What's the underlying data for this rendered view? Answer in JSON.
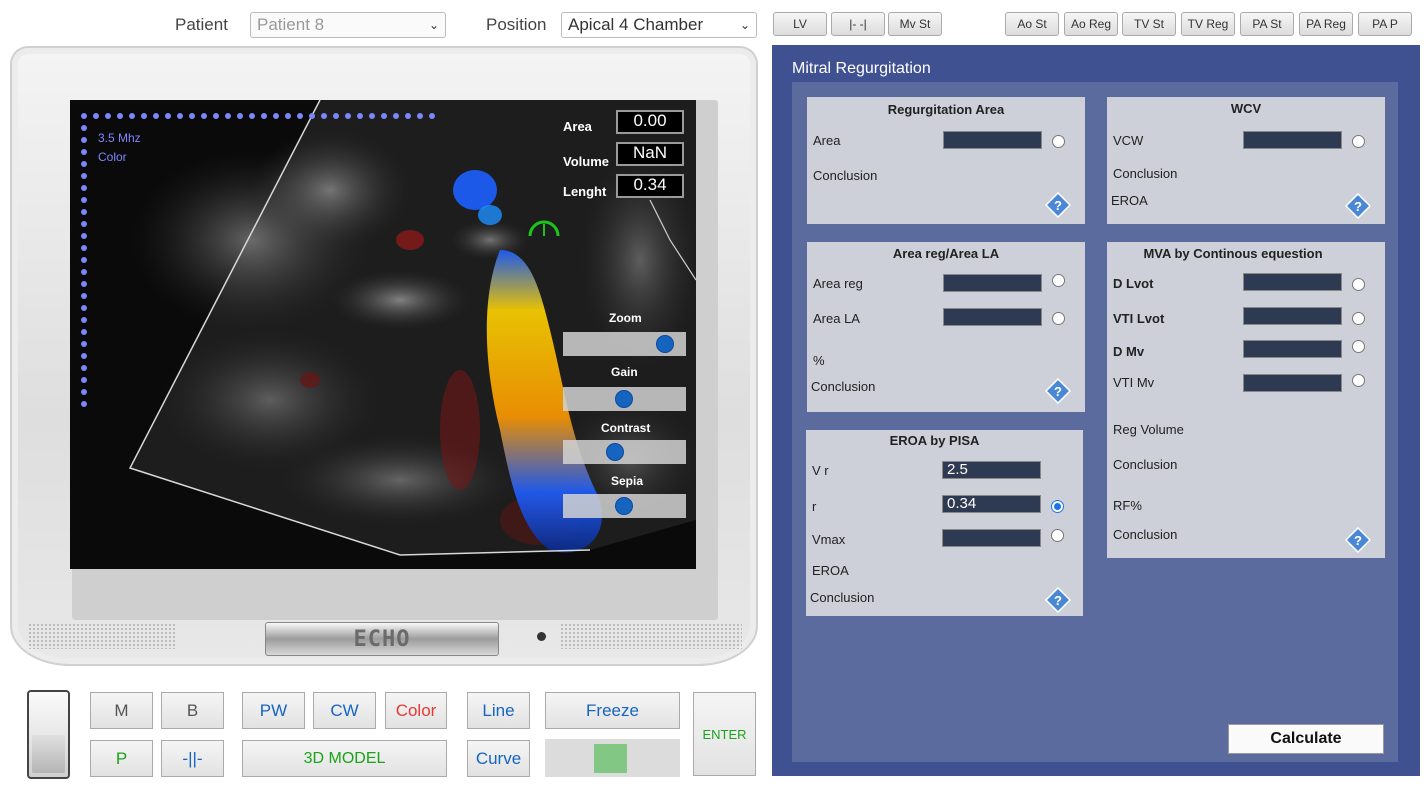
{
  "top": {
    "patient_label": "Patient",
    "patient_value": "Patient 8",
    "position_label": "Position",
    "position_value": "Apical 4 Chamber",
    "mode_buttons": [
      "LV",
      "|- -|",
      "Mv St"
    ],
    "valve_buttons": [
      "Ao St",
      "Ao Reg",
      "TV St",
      "TV Reg",
      "PA St",
      "PA Reg",
      "PA P"
    ]
  },
  "screen": {
    "freq": "3.5 Mhz",
    "mode": "Color",
    "area_label": "Area",
    "area_value": "0.00",
    "volume_label": "Volume",
    "volume_value": "NaN",
    "length_label": "Lenght",
    "length_value": "0.34",
    "sliders": {
      "zoom": {
        "label": "Zoom",
        "level": 0.9
      },
      "gain": {
        "label": "Gain",
        "level": 0.5
      },
      "contrast": {
        "label": "Contrast",
        "level": 0.42
      },
      "sepia": {
        "label": "Sepia",
        "level": 0.5
      }
    }
  },
  "monitor": {
    "brand": "ECHO"
  },
  "controls": {
    "m": "M",
    "b": "B",
    "pw": "PW",
    "cw": "CW",
    "color": "Color",
    "line": "Line",
    "freeze": "Freeze",
    "enter": "ENTER",
    "p": "P",
    "sep": "-||-",
    "model": "3D MODEL",
    "curve": "Curve"
  },
  "panel": {
    "title": "Mitral Regurgitation",
    "regurg_area": {
      "title": "Regurgitation Area",
      "area": "Area",
      "conclusion": "Conclusion"
    },
    "wcv": {
      "title": "WCV",
      "vcw": "VCW",
      "conclusion": "Conclusion",
      "eroa": "EROA"
    },
    "area_reg_la": {
      "title": "Area reg/Area LA",
      "area_reg": "Area reg",
      "area_la": "Area LA",
      "pct": "%",
      "conclusion": "Conclusion"
    },
    "mva": {
      "title": "MVA by Continous equestion",
      "d_lvot": "D Lvot",
      "vti_lvot": "VTI Lvot",
      "d_mv": "D Mv",
      "vti_mv": "VTI Mv",
      "reg_volume": "Reg Volume",
      "conclusion": "Conclusion",
      "rf": "RF%",
      "conclusion2": "Conclusion"
    },
    "pisa": {
      "title": "EROA by PISA",
      "vr": "V r",
      "vr_value": "2.5",
      "r": "r",
      "r_value": "0.34",
      "vmax": "Vmax",
      "eroa": "EROA",
      "conclusion": "Conclusion"
    },
    "calculate": "Calculate"
  },
  "colors": {
    "panel": "#405191",
    "panel_inner": "#5c6b9d",
    "card": "#cdd0d8",
    "field": "#2e3a52"
  }
}
